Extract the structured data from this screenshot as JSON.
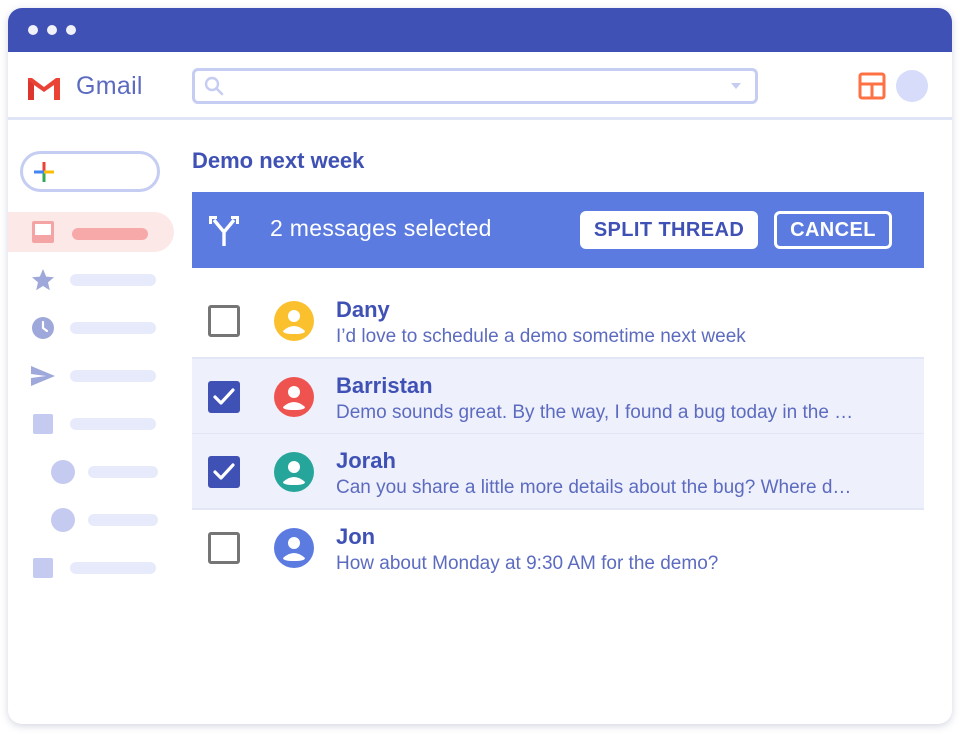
{
  "app": {
    "name": "Gmail"
  },
  "colors": {
    "brand": "#3f51b5",
    "accent": "#5c7be0",
    "selected_row": "#eef0fb",
    "gmail_red": "#ea4335",
    "layout_icon": "#ff7043"
  },
  "search": {
    "placeholder": ""
  },
  "thread": {
    "title": "Demo next week"
  },
  "selection_bar": {
    "label": "2 messages selected",
    "split_button": "SPLIT THREAD",
    "cancel_button": "CANCEL"
  },
  "messages": [
    {
      "sender": "Dany",
      "snippet": "I’d love to schedule a demo sometime next week",
      "checked": false,
      "avatar_color": "#fbc02d"
    },
    {
      "sender": "Barristan",
      "snippet": "Demo sounds great. By the way, I found a bug today in the …",
      "checked": true,
      "avatar_color": "#ef5350"
    },
    {
      "sender": "Jorah",
      "snippet": "Can you share a little more details about the bug? Where d…",
      "checked": true,
      "avatar_color": "#26a69a"
    },
    {
      "sender": "Jon",
      "snippet": "How about Monday at 9:30 AM for the demo?",
      "checked": false,
      "avatar_color": "#5c7be0"
    }
  ],
  "sidebar": {
    "items": [
      {
        "icon": "inbox-icon",
        "active": true
      },
      {
        "icon": "star-icon",
        "active": false
      },
      {
        "icon": "clock-icon",
        "active": false
      },
      {
        "icon": "send-icon",
        "active": false
      },
      {
        "icon": "label-icon",
        "active": false
      },
      {
        "icon": "label-dot-icon",
        "active": false
      },
      {
        "icon": "label-dot-icon",
        "active": false
      },
      {
        "icon": "label-icon",
        "active": false
      }
    ]
  }
}
